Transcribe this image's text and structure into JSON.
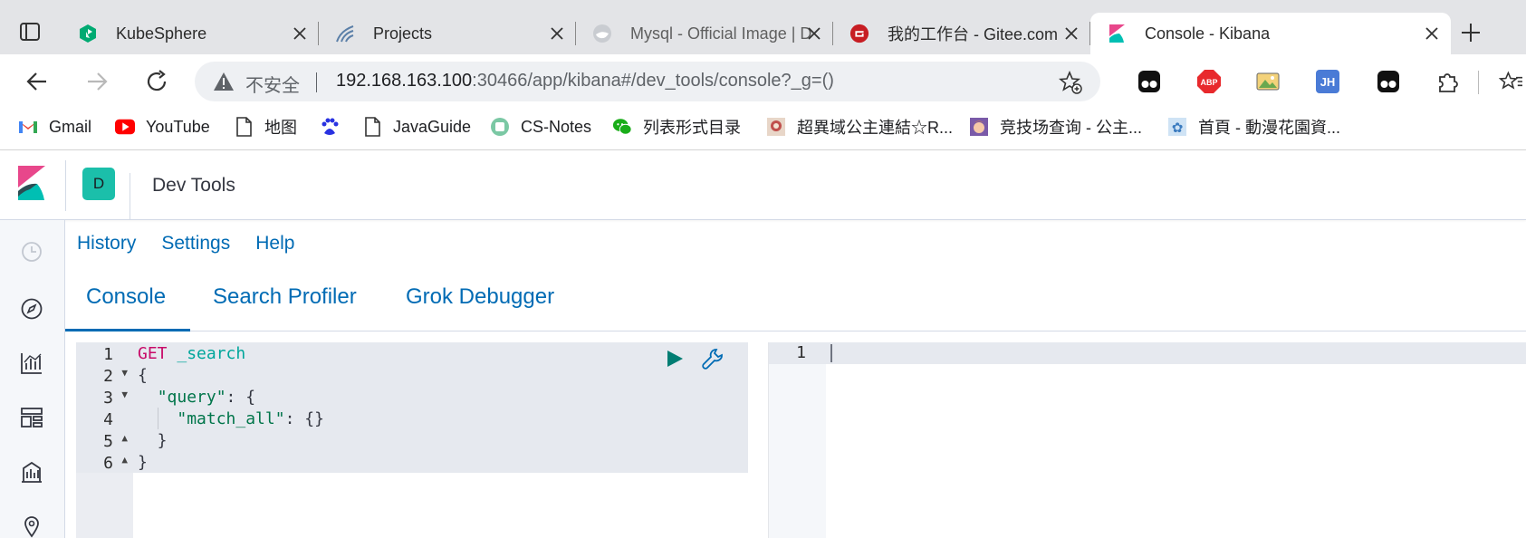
{
  "browser": {
    "tabs": [
      {
        "title": "KubeSphere",
        "icon": "kubesphere-icon"
      },
      {
        "title": "Projects",
        "icon": "projects-icon"
      },
      {
        "title": "Mysql - Official Image | Do",
        "icon": "docker-icon"
      },
      {
        "title": "我的工作台 - Gitee.com",
        "icon": "gitee-icon"
      },
      {
        "title": "Console - Kibana",
        "icon": "kibana-icon",
        "active": true
      }
    ],
    "address": {
      "security_label": "不安全",
      "url_host": "192.168.163.100",
      "url_rest": ":30466/app/kibana#/dev_tools/console?_g=()"
    },
    "bookmarks": [
      {
        "label": "Gmail",
        "icon": "gmail-icon"
      },
      {
        "label": "YouTube",
        "icon": "youtube-icon"
      },
      {
        "label": "地图",
        "icon": "page-icon"
      },
      {
        "label": "",
        "icon": "baidu-icon"
      },
      {
        "label": "JavaGuide",
        "icon": "page-icon"
      },
      {
        "label": "CS-Notes",
        "icon": "cs-notes-icon"
      },
      {
        "label": "列表形式目录",
        "icon": "wechat-icon"
      },
      {
        "label": "超異域公主連結☆R...",
        "icon": "game-icon"
      },
      {
        "label": "竞技场查询 - 公主...",
        "icon": "anime-icon"
      },
      {
        "label": "首頁 - 動漫花園資...",
        "icon": "flower-icon"
      }
    ],
    "extension_badges": {
      "abp": "ABP",
      "jh": "JH"
    }
  },
  "kibana": {
    "space_initial": "D",
    "page_title": "Dev Tools",
    "top_links": [
      "History",
      "Settings",
      "Help"
    ],
    "tabs": [
      "Console",
      "Search Profiler",
      "Grok Debugger"
    ],
    "active_tab": "Console"
  },
  "editor": {
    "line_numbers": [
      "1",
      "2",
      "3",
      "4",
      "5",
      "6"
    ],
    "lines": [
      {
        "method": "GET",
        "rest": " _search"
      },
      {
        "text": "{"
      },
      {
        "indent": "  ",
        "key": "\"query\"",
        "after": ": {"
      },
      {
        "indent": "    ",
        "key": "\"match_all\"",
        "after": ": {}"
      },
      {
        "text": "  }"
      },
      {
        "text": "}"
      }
    ]
  },
  "output": {
    "line_numbers": [
      "1"
    ]
  },
  "colors": {
    "link": "#006bb4",
    "method": "#c80a68",
    "json_key": "#00754a",
    "kibana_teal": "#1bbfaa"
  }
}
